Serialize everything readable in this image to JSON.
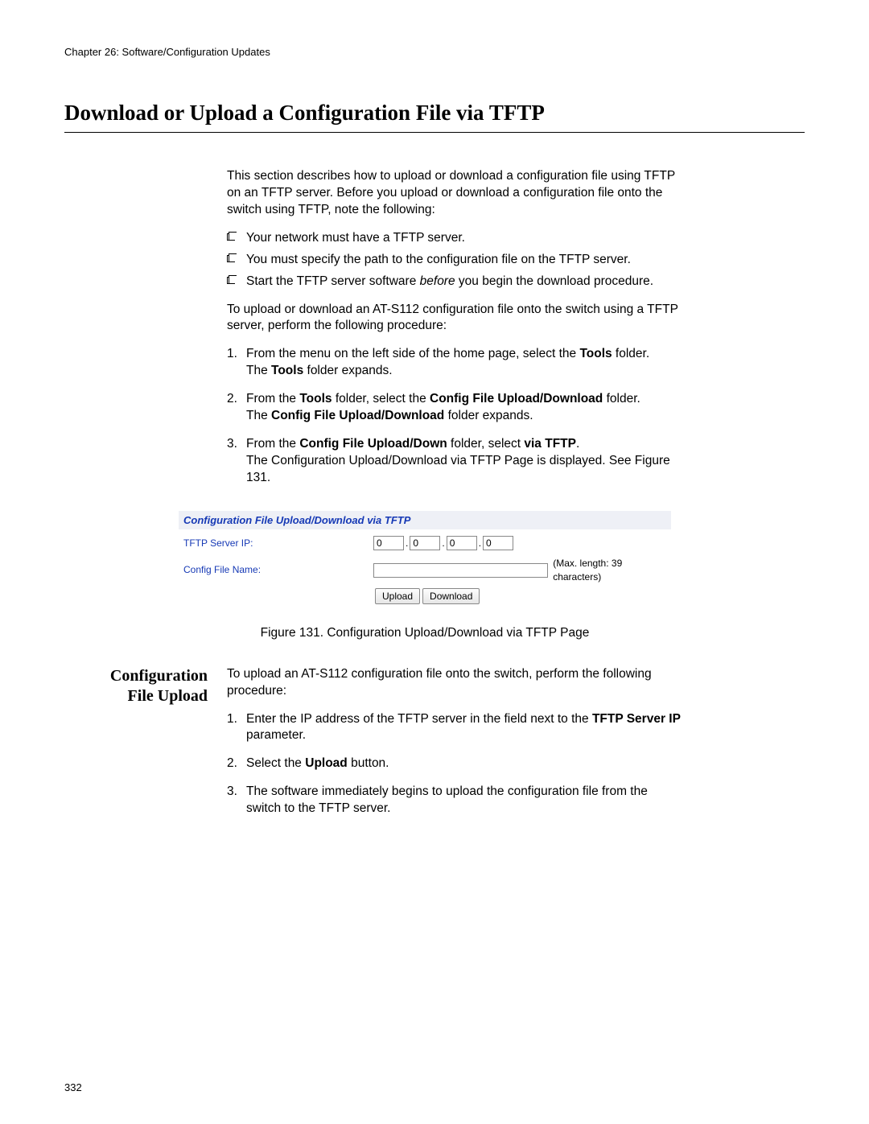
{
  "chapter_header": "Chapter 26: Software/Configuration Updates",
  "page_title": "Download or Upload a Configuration File via TFTP",
  "intro_para": "This section describes how to upload or download a configuration file using TFTP on an TFTP server. Before you upload or download a configuration file onto the switch using TFTP, note the following:",
  "notes": [
    "Your network must have a TFTP server.",
    "You must specify the path to the configuration file on the TFTP server.",
    {
      "pre": "Start the TFTP server software ",
      "em": "before",
      "post": " you begin the download procedure."
    }
  ],
  "para2": "To upload or download an AT-S112 configuration file onto the switch using a TFTP server, perform the following procedure:",
  "steps1": [
    {
      "line1_pre": "From the menu on the left side of the home page, select the ",
      "line1_bold": "Tools",
      "line1_post": " folder.",
      "line2_pre": "The ",
      "line2_bold": "Tools",
      "line2_post": " folder expands."
    },
    {
      "line1_pre": "From the ",
      "line1_bold": "Tools",
      "line1_mid": " folder, select the ",
      "line1_bold2": "Config File Upload/Download",
      "line1_post": " folder.",
      "line2_pre": "The ",
      "line2_bold": "Config File Upload/Download",
      "line2_post": " folder expands."
    },
    {
      "line1_pre": "From the ",
      "line1_bold": "Config File Upload/Down",
      "line1_mid": " folder, select ",
      "line1_bold2": "via TFTP",
      "line1_post": ".",
      "line2": "The Configuration Upload/Download via TFTP Page is displayed. See Figure 131."
    }
  ],
  "dialog": {
    "title": "Configuration File Upload/Download via TFTP",
    "label_ip": "TFTP Server IP:",
    "label_file": "Config File Name:",
    "ip": [
      "0",
      "0",
      "0",
      "0"
    ],
    "filename": "",
    "hint": "(Max. length: 39 characters)",
    "btn_upload": "Upload",
    "btn_download": "Download"
  },
  "figure_caption": "Figure 131. Configuration Upload/Download via TFTP Page",
  "side_heading_line1": "Configuration",
  "side_heading_line2": "File Upload",
  "para3": "To upload an AT-S112 configuration file onto the switch, perform the following procedure:",
  "steps2": [
    {
      "pre": "Enter the IP address of the TFTP server in the field next to the ",
      "bold": "TFTP Server IP",
      "post": " parameter."
    },
    {
      "pre": "Select the ",
      "bold": "Upload",
      "post": " button."
    },
    {
      "text": "The software immediately begins to upload the configuration file from the switch to the TFTP server."
    }
  ],
  "page_number": "332"
}
